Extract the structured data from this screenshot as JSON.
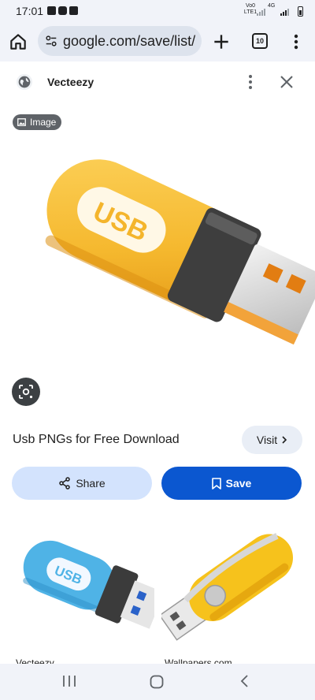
{
  "status_bar": {
    "time": "17:01",
    "network_left": "Vo0 LTE1",
    "network_right": "4G"
  },
  "browser": {
    "url": "google.com/save/list/",
    "tab_count": "10"
  },
  "source": {
    "name": "Vecteezy"
  },
  "image": {
    "badge_label": "Image",
    "usb_text": "USB",
    "accent_color": "#f5b82e"
  },
  "result": {
    "title": "Usb PNGs for Free Download",
    "visit_label": "Visit"
  },
  "actions": {
    "share_label": "Share",
    "save_label": "Save"
  },
  "related": [
    {
      "source": "Vecteezy",
      "usb_text": "USB",
      "color": "#4fb3e6"
    },
    {
      "source": "Wallpapers.com",
      "color": "#f6c21c"
    }
  ],
  "colors": {
    "save_button": "#0b57d0",
    "share_button": "#d3e3fd",
    "chrome_bg": "#f1f3f9"
  }
}
